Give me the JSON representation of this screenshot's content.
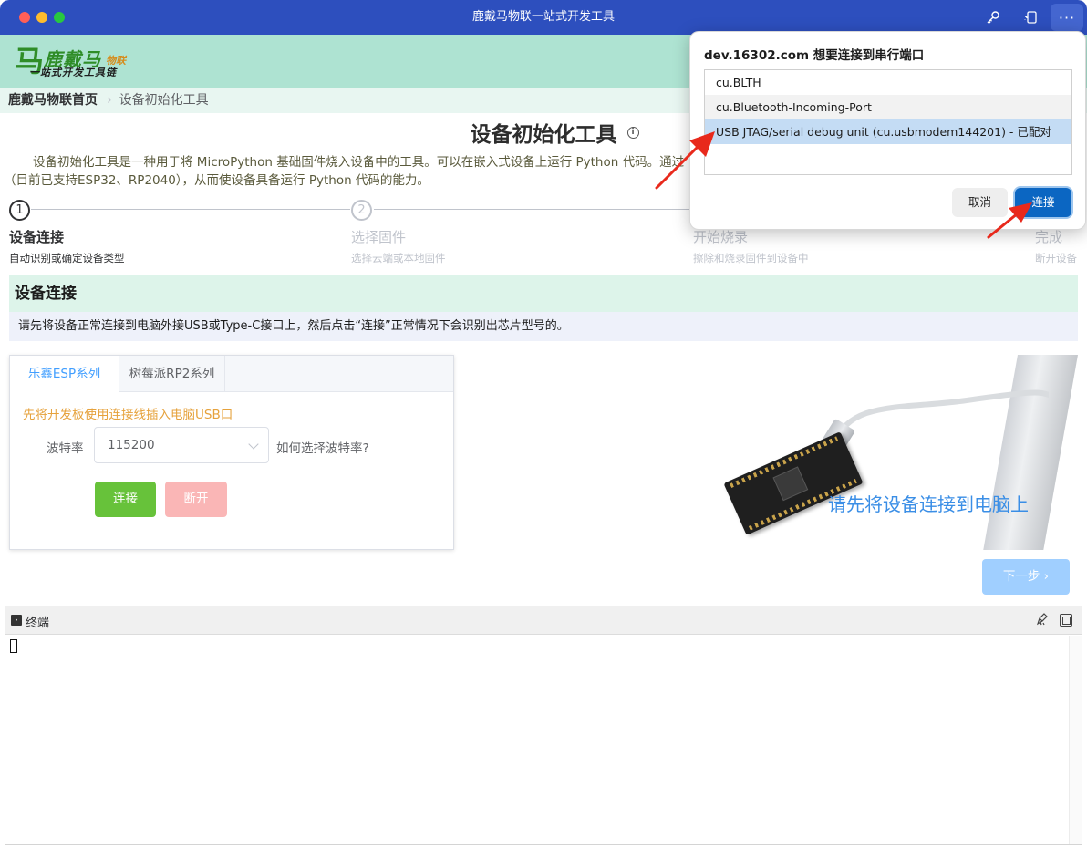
{
  "window": {
    "title": "鹿戴马物联一站式开发工具"
  },
  "brand": {
    "mark": "马",
    "name": "鹿戴马",
    "name_suffix": "物联",
    "tagline": "一站式开发工具链"
  },
  "breadcrumb": {
    "home": "鹿戴马物联首页",
    "separator": "›",
    "current": "设备初始化工具"
  },
  "page": {
    "title": "设备初始化工具",
    "intro_line1": "设备初始化工具是一种用于将 MicroPython 基础固件烧入设备中的工具。可以在嵌入式设备上运行 Python 代码。通过",
    "intro_line2": "（目前已支持ESP32、RP2040），从而使设备具备运行 Python 代码的能力。"
  },
  "steps": [
    {
      "number": "1",
      "title": "设备连接",
      "desc": "自动识别或确定设备类型",
      "active": true
    },
    {
      "number": "2",
      "title": "选择固件",
      "desc": "选择云端或本地固件",
      "active": false
    },
    {
      "number": "3",
      "title": "开始烧录",
      "desc": "擦除和烧录固件到设备中",
      "active": false
    },
    {
      "number": "4",
      "title": "完成",
      "desc": "断开设备",
      "active": false
    }
  ],
  "section": {
    "title": "设备连接",
    "tip": "请先将设备正常连接到电脑外接USB或Type-C接口上，然后点击“连接”正常情况下会识别出芯片型号的。"
  },
  "tabs": [
    {
      "label": "乐鑫ESP系列",
      "active": true
    },
    {
      "label": "树莓派RP2系列",
      "active": false
    }
  ],
  "form": {
    "hint": "先将开发板使用连接线插入电脑USB口",
    "baud_label": "波特率",
    "baud_value": "115200",
    "baud_help": "如何选择波特率?",
    "connect_label": "连接",
    "disconnect_label": "断开"
  },
  "illustration": {
    "caption": "请先将设备连接到电脑上"
  },
  "next_label": "下一步 ›",
  "terminal": {
    "title": "终端"
  },
  "serial_dialog": {
    "title": "dev.16302.com 想要连接到串行端口",
    "ports": [
      "cu.BLTH",
      "cu.Bluetooth-Incoming-Port",
      "USB JTAG/serial debug unit (cu.usbmodem144201) - 已配对"
    ],
    "selected_index": 2,
    "cancel_label": "取消",
    "connect_label": "连接"
  },
  "colors": {
    "titlebar": "#2d4fbe",
    "header": "#aee3d2",
    "primary": "#409eff",
    "success": "#67c23a",
    "danger_light": "#fab6b6",
    "warning": "#e6a23c",
    "dialog_primary": "#0b66c2",
    "arrow": "#e8291c"
  }
}
